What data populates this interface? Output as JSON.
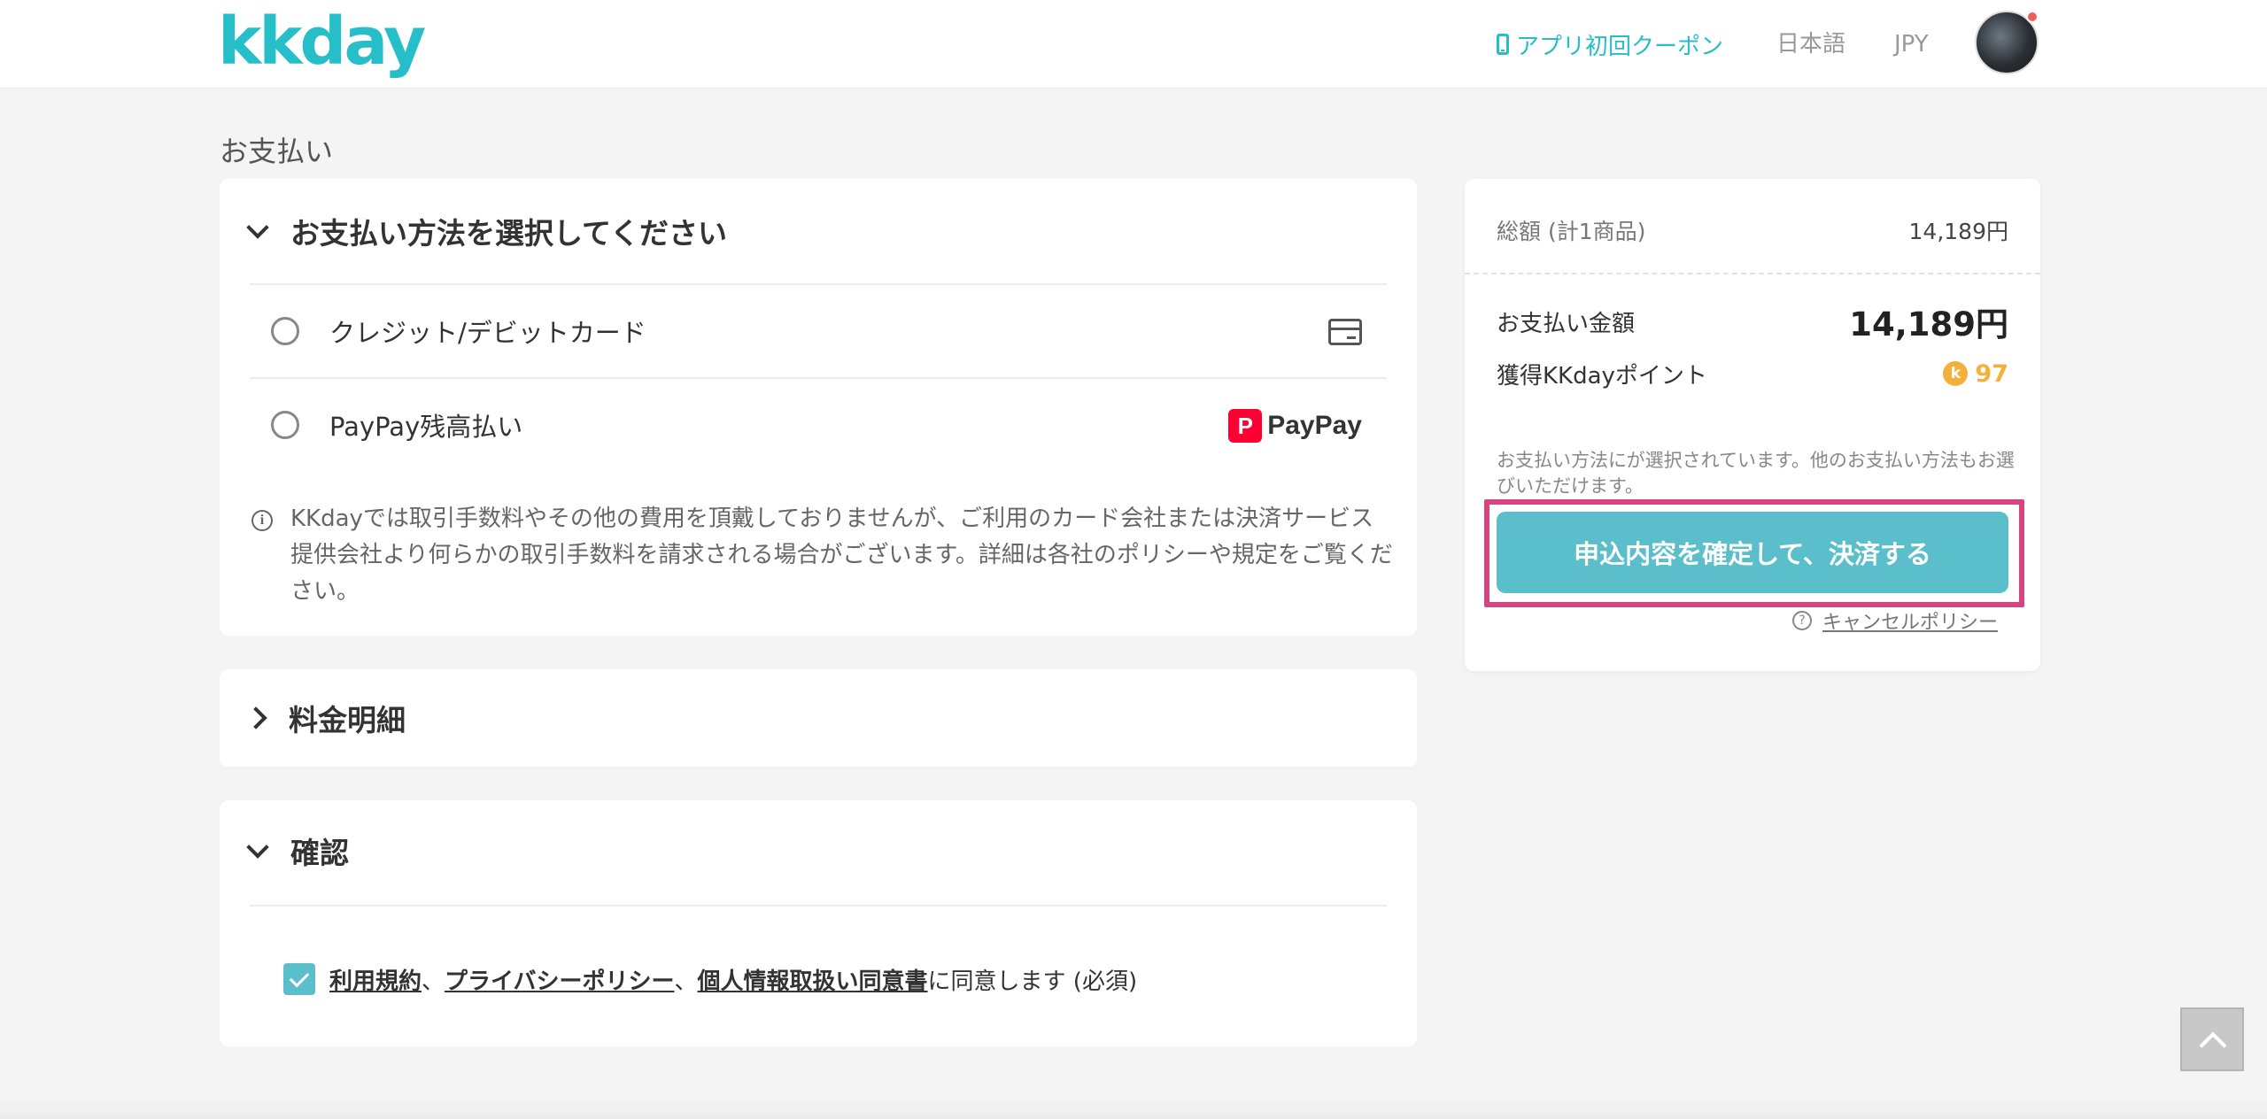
{
  "header": {
    "logo": "kkday",
    "coupon_label": "アプリ初回クーポン",
    "language": "日本語",
    "currency": "JPY"
  },
  "page_title": "お支払い",
  "payment_section": {
    "title": "お支払い方法を選択してください",
    "options": [
      {
        "label": "クレジット/デビットカード",
        "icon": "credit-card-icon",
        "selected": false
      },
      {
        "label": "PayPay残高払い",
        "icon": "paypay-logo",
        "logo_text": "PayPay",
        "logo_mark": "P",
        "selected": false
      }
    ],
    "note": "KKdayでは取引手数料やその他の費用を頂戴しておりませんが、ご利用のカード会社または決済サービス提供会社より何らかの取引手数料を請求される場合がございます。詳細は各社のポリシーや規定をご覧ください。"
  },
  "price_section": {
    "title": "料金明細"
  },
  "confirm_section": {
    "title": "確認",
    "agree": {
      "checked": true,
      "link_terms": "利用規約",
      "sep1": "、",
      "link_privacy": "プライバシーポリシー",
      "sep2": "、",
      "link_personal": "個人情報取扱い同意書",
      "suffix": "に同意します (必須)"
    }
  },
  "summary": {
    "total_label": "総額 (計1商品)",
    "total_value": "14,189円",
    "pay_amount_label": "お支払い金額",
    "pay_amount_value": "14,189円",
    "points_label": "獲得KKdayポイント",
    "points_coin": "k",
    "points_value": "97",
    "note": "お支払い方法にが選択されています。他のお支払い方法もお選びいただけます。",
    "confirm_button": "申込内容を確定して、決済する",
    "cancel_policy": "キャンセルポリシー"
  },
  "colors": {
    "brand": "#26bec9",
    "button": "#5bbfcb",
    "highlight": "#d6457f",
    "points": "#f3b13c",
    "paypay": "#ff0033"
  }
}
